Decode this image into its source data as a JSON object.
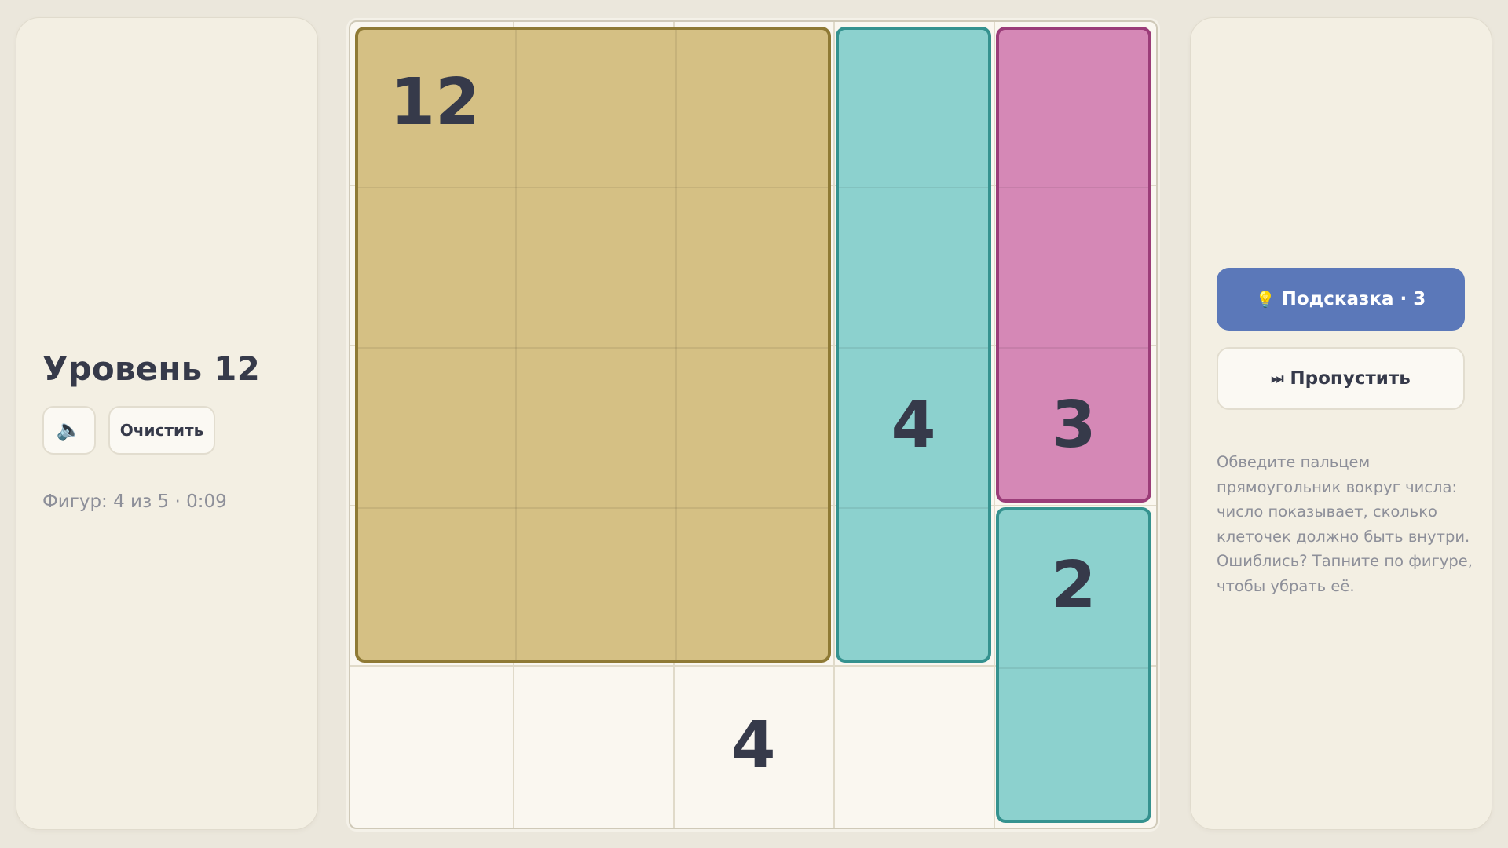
{
  "left_panel": {
    "level_title": "Уровень 12",
    "sound_icon": "speaker-icon",
    "sound_glyph": "🔈",
    "clear_label": "Очистить",
    "status_text": "Фигур: 4 из 5 · 0:09"
  },
  "right_panel": {
    "hint_icon": "lightbulb-icon",
    "hint_glyph": "💡",
    "hint_label": "Подсказка · 3",
    "skip_icon": "skip-forward-icon",
    "skip_glyph": "⏭",
    "skip_label": "Пропустить",
    "instructions": "Обведите пальцем прямоугольник вокруг числа: число показывает, сколько клеточек должно быть внутри. Ошиблись? Тапните по фигуре, чтобы убрать её."
  },
  "board": {
    "cols": 5,
    "rows": 5,
    "clues": [
      {
        "row": 0,
        "col": 0,
        "value": "12"
      },
      {
        "row": 2,
        "col": 3,
        "value": "4"
      },
      {
        "row": 2,
        "col": 4,
        "value": "3"
      },
      {
        "row": 3,
        "col": 4,
        "value": "2"
      },
      {
        "row": 4,
        "col": 2,
        "value": "4"
      }
    ],
    "shapes": [
      {
        "name": "shape-12",
        "row": 0,
        "col": 0,
        "rows": 4,
        "cols": 3,
        "color": "gold"
      },
      {
        "name": "shape-4",
        "row": 0,
        "col": 3,
        "rows": 4,
        "cols": 1,
        "color": "teal"
      },
      {
        "name": "shape-3",
        "row": 0,
        "col": 4,
        "rows": 3,
        "cols": 1,
        "color": "pink"
      },
      {
        "name": "shape-2",
        "row": 3,
        "col": 4,
        "rows": 2,
        "cols": 1,
        "color": "teal"
      }
    ],
    "colors": {
      "gold": "#d5c084",
      "teal": "#8cd1ce",
      "pink": "#d588b6",
      "accent": "#5b78b9"
    }
  }
}
